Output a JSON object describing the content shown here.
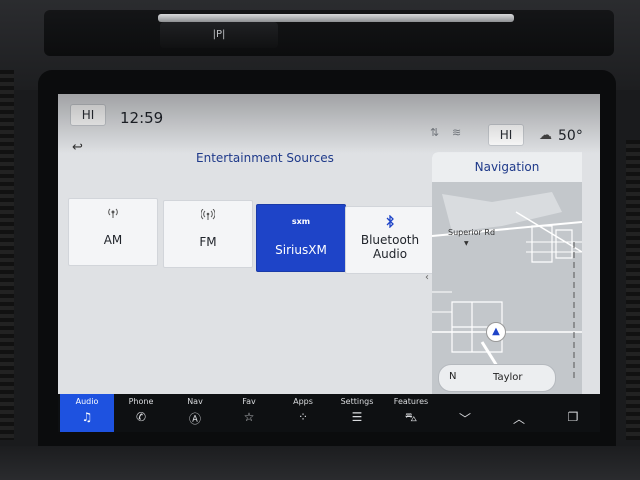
{
  "status_bar": {
    "hi_left": "HI",
    "clock": "12:59",
    "hi_right": "HI",
    "temperature": "50°",
    "icons": [
      "signal-icon",
      "wifi-icon",
      "weather-icon"
    ]
  },
  "panel": {
    "title": "Entertainment Sources",
    "back_icon": "back-arrow-icon"
  },
  "sources": [
    {
      "label": "AM",
      "icon": "antenna-icon"
    },
    {
      "label": "FM",
      "icon": "broadcast-icon"
    },
    {
      "label": "SiriusXM",
      "icon_text": "sxm",
      "selected": true
    },
    {
      "label": "Bluetooth Audio",
      "icon": "bluetooth-icon"
    }
  ],
  "navigation": {
    "title": "Navigation",
    "road_label": "Superior Rd",
    "heading": "N",
    "street": "Taylor"
  },
  "dock": [
    {
      "label": "Audio",
      "icon": "music-note-icon",
      "active": true
    },
    {
      "label": "Phone",
      "icon": "phone-icon"
    },
    {
      "label": "Nav",
      "icon": "navigation-icon"
    },
    {
      "label": "Fav",
      "icon": "star-icon"
    },
    {
      "label": "Apps",
      "icon": "apps-grid-icon"
    },
    {
      "label": "Settings",
      "icon": "settings-sliders-icon"
    },
    {
      "label": "Features",
      "icon": "car-icon"
    },
    {
      "label": "",
      "icon": "chevron-down-icon"
    },
    {
      "label": "",
      "icon": "chevron-up-icon"
    },
    {
      "label": "",
      "icon": "copy-icon"
    }
  ],
  "hardware": {
    "park_button": "|P|"
  },
  "colors": {
    "accent": "#1e44c8",
    "dock_active": "#1e52e0",
    "title_blue": "#1f3a8a",
    "screen_bg": "#dfe1e4"
  }
}
